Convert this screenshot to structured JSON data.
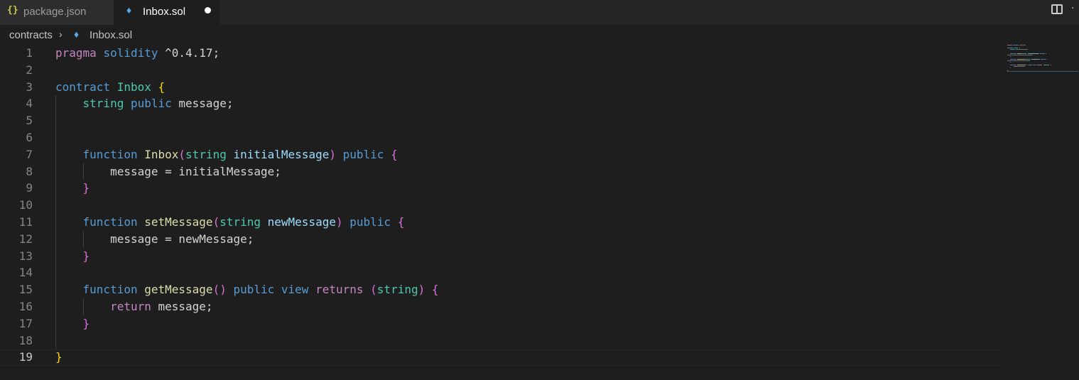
{
  "tabs": [
    {
      "icon": "{}",
      "icon_name": "json-braces-icon",
      "label": "package.json",
      "active": false
    },
    {
      "icon": "♦",
      "icon_name": "solidity-icon",
      "label": "Inbox.sol",
      "active": true,
      "dirty": true
    }
  ],
  "breadcrumb": {
    "folder": "contracts",
    "separator": "›",
    "file_icon": "♦",
    "file": "Inbox.sol"
  },
  "actions": {
    "split_icon_name": "split-editor-icon",
    "more_icon": "·"
  },
  "editor": {
    "current_line": 19,
    "lines": [
      {
        "n": "1",
        "tokens": [
          {
            "t": "pragma",
            "c": "kw"
          },
          {
            "t": " ",
            "c": "plain"
          },
          {
            "t": "solidity",
            "c": "sto"
          },
          {
            "t": " ^0.4.17;",
            "c": "plain"
          }
        ]
      },
      {
        "n": "2",
        "tokens": []
      },
      {
        "n": "3",
        "tokens": [
          {
            "t": "contract",
            "c": "sto"
          },
          {
            "t": " ",
            "c": "plain"
          },
          {
            "t": "Inbox",
            "c": "type"
          },
          {
            "t": " ",
            "c": "plain"
          },
          {
            "t": "{",
            "c": "b1"
          }
        ]
      },
      {
        "n": "4",
        "tokens": [
          {
            "t": "    ",
            "c": "plain"
          },
          {
            "t": "string",
            "c": "type"
          },
          {
            "t": " ",
            "c": "plain"
          },
          {
            "t": "public",
            "c": "sto"
          },
          {
            "t": " message;",
            "c": "plain"
          }
        ]
      },
      {
        "n": "5",
        "tokens": []
      },
      {
        "n": "6",
        "tokens": []
      },
      {
        "n": "7",
        "tokens": [
          {
            "t": "    ",
            "c": "plain"
          },
          {
            "t": "function",
            "c": "sto"
          },
          {
            "t": " ",
            "c": "plain"
          },
          {
            "t": "Inbox",
            "c": "fn"
          },
          {
            "t": "(",
            "c": "b2"
          },
          {
            "t": "string",
            "c": "type"
          },
          {
            "t": " ",
            "c": "plain"
          },
          {
            "t": "initialMessage",
            "c": "var"
          },
          {
            "t": ")",
            "c": "b2"
          },
          {
            "t": " ",
            "c": "plain"
          },
          {
            "t": "public",
            "c": "sto"
          },
          {
            "t": " ",
            "c": "plain"
          },
          {
            "t": "{",
            "c": "b2"
          }
        ]
      },
      {
        "n": "8",
        "tokens": [
          {
            "t": "        message = initialMessage;",
            "c": "plain"
          }
        ]
      },
      {
        "n": "9",
        "tokens": [
          {
            "t": "    ",
            "c": "plain"
          },
          {
            "t": "}",
            "c": "b2"
          }
        ]
      },
      {
        "n": "10",
        "tokens": []
      },
      {
        "n": "11",
        "tokens": [
          {
            "t": "    ",
            "c": "plain"
          },
          {
            "t": "function",
            "c": "sto"
          },
          {
            "t": " ",
            "c": "plain"
          },
          {
            "t": "setMessage",
            "c": "fn"
          },
          {
            "t": "(",
            "c": "b2"
          },
          {
            "t": "string",
            "c": "type"
          },
          {
            "t": " ",
            "c": "plain"
          },
          {
            "t": "newMessage",
            "c": "var"
          },
          {
            "t": ")",
            "c": "b2"
          },
          {
            "t": " ",
            "c": "plain"
          },
          {
            "t": "public",
            "c": "sto"
          },
          {
            "t": " ",
            "c": "plain"
          },
          {
            "t": "{",
            "c": "b2"
          }
        ]
      },
      {
        "n": "12",
        "tokens": [
          {
            "t": "        message = newMessage;",
            "c": "plain"
          }
        ]
      },
      {
        "n": "13",
        "tokens": [
          {
            "t": "    ",
            "c": "plain"
          },
          {
            "t": "}",
            "c": "b2"
          }
        ]
      },
      {
        "n": "14",
        "tokens": []
      },
      {
        "n": "15",
        "tokens": [
          {
            "t": "    ",
            "c": "plain"
          },
          {
            "t": "function",
            "c": "sto"
          },
          {
            "t": " ",
            "c": "plain"
          },
          {
            "t": "getMessage",
            "c": "fn"
          },
          {
            "t": "()",
            "c": "b2"
          },
          {
            "t": " ",
            "c": "plain"
          },
          {
            "t": "public",
            "c": "sto"
          },
          {
            "t": " ",
            "c": "plain"
          },
          {
            "t": "view",
            "c": "sto"
          },
          {
            "t": " ",
            "c": "plain"
          },
          {
            "t": "returns",
            "c": "kw"
          },
          {
            "t": " ",
            "c": "plain"
          },
          {
            "t": "(",
            "c": "b2"
          },
          {
            "t": "string",
            "c": "type"
          },
          {
            "t": ")",
            "c": "b2"
          },
          {
            "t": " ",
            "c": "plain"
          },
          {
            "t": "{",
            "c": "b2"
          }
        ]
      },
      {
        "n": "16",
        "tokens": [
          {
            "t": "        ",
            "c": "plain"
          },
          {
            "t": "return",
            "c": "kw"
          },
          {
            "t": " message;",
            "c": "plain"
          }
        ]
      },
      {
        "n": "17",
        "tokens": [
          {
            "t": "    ",
            "c": "plain"
          },
          {
            "t": "}",
            "c": "b2"
          }
        ]
      },
      {
        "n": "18",
        "tokens": []
      },
      {
        "n": "19",
        "tokens": [
          {
            "t": "}",
            "c": "b1"
          }
        ]
      }
    ]
  },
  "colors": {
    "background": "#1e1e1e",
    "tab_bar": "#252526",
    "keyword": "#c586c0",
    "storage": "#569cd6",
    "type": "#4ec9b0",
    "function": "#dcdcaa",
    "variable": "#9cdcfe",
    "bracket_level1": "#ffd700",
    "bracket_level2": "#da70d6"
  }
}
